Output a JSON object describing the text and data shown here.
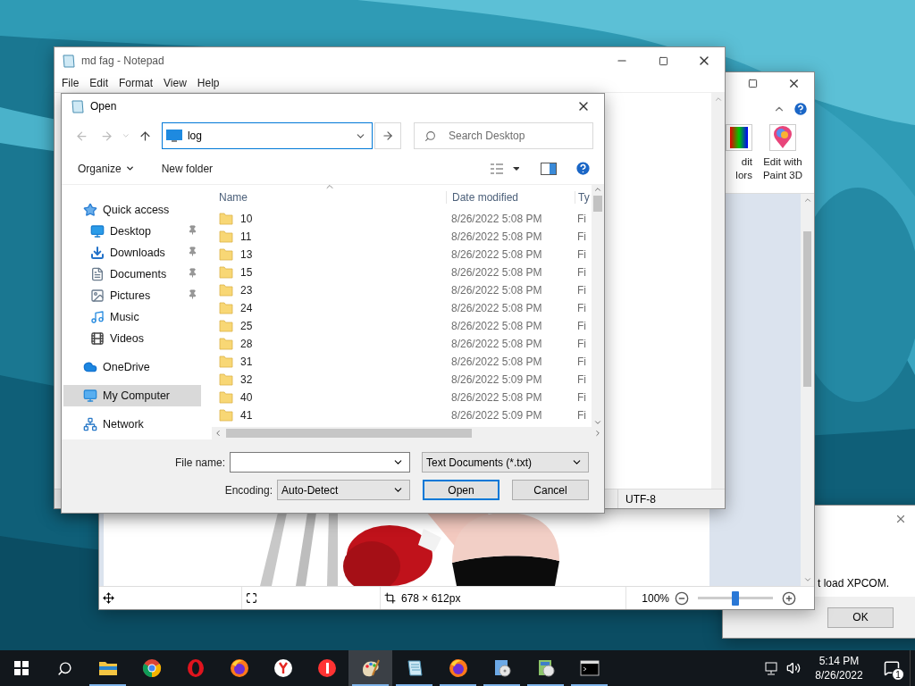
{
  "paint_window": {
    "ribbon_buttons": [
      {
        "kind": "colors",
        "lines": [
          "dit",
          "lors"
        ]
      },
      {
        "kind": "paint3d",
        "lines": [
          "Edit with",
          "Paint 3D"
        ]
      }
    ],
    "zoom_slider": {
      "level": 0.5
    },
    "status_bar": {
      "image_size": "678 × 612px",
      "zoom": "100%"
    }
  },
  "notepad": {
    "title": "md fag - Notepad",
    "menu": [
      "File",
      "Edit",
      "Format",
      "View",
      "Help"
    ],
    "status_bar": {
      "encoding": "UTF-8"
    }
  },
  "open_dialog": {
    "title": "Open",
    "address": "log",
    "search": {
      "placeholder": "Search Desktop"
    },
    "toolbar": {
      "organize": "Organize",
      "new_folder": "New folder"
    },
    "nav_items": [
      {
        "label": "Quick access",
        "kind": "quick",
        "selected": false,
        "children": [
          {
            "label": "Desktop",
            "kind": "desktop",
            "pinned": true,
            "selected": false
          },
          {
            "label": "Downloads",
            "kind": "downloads",
            "pinned": true,
            "selected": false
          },
          {
            "label": "Documents",
            "kind": "documents",
            "pinned": true,
            "selected": false
          },
          {
            "label": "Pictures",
            "kind": "pictures",
            "pinned": true,
            "selected": false
          },
          {
            "label": "Music",
            "kind": "music",
            "pinned": false,
            "selected": false
          },
          {
            "label": "Videos",
            "kind": "videos",
            "pinned": false,
            "selected": false
          }
        ]
      },
      {
        "label": "OneDrive",
        "kind": "onedrive",
        "selected": false
      },
      {
        "label": "My Computer",
        "kind": "computer",
        "selected": true
      },
      {
        "label": "Network",
        "kind": "network",
        "selected": false
      }
    ],
    "columns": [
      "Name",
      "Date modified",
      "Ty"
    ],
    "rows": [
      {
        "name": "10",
        "date": "8/26/2022 5:08 PM",
        "type": "Fi"
      },
      {
        "name": "11",
        "date": "8/26/2022 5:08 PM",
        "type": "Fi"
      },
      {
        "name": "13",
        "date": "8/26/2022 5:08 PM",
        "type": "Fi"
      },
      {
        "name": "15",
        "date": "8/26/2022 5:08 PM",
        "type": "Fi"
      },
      {
        "name": "23",
        "date": "8/26/2022 5:08 PM",
        "type": "Fi"
      },
      {
        "name": "24",
        "date": "8/26/2022 5:08 PM",
        "type": "Fi"
      },
      {
        "name": "25",
        "date": "8/26/2022 5:08 PM",
        "type": "Fi"
      },
      {
        "name": "28",
        "date": "8/26/2022 5:08 PM",
        "type": "Fi"
      },
      {
        "name": "31",
        "date": "8/26/2022 5:08 PM",
        "type": "Fi"
      },
      {
        "name": "32",
        "date": "8/26/2022 5:09 PM",
        "type": "Fi"
      },
      {
        "name": "40",
        "date": "8/26/2022 5:08 PM",
        "type": "Fi"
      },
      {
        "name": "41",
        "date": "8/26/2022 5:09 PM",
        "type": "Fi"
      }
    ],
    "file_name": {
      "label": "File name:"
    },
    "file_type": "Text Documents (*.txt)",
    "encoding": {
      "label": "Encoding:",
      "value": "Auto-Detect"
    },
    "buttons": [
      "Open",
      "Cancel"
    ]
  },
  "error_dialog": {
    "message": "t load XPCOM.",
    "button": "OK"
  },
  "taskbar": {
    "apps": [
      {
        "kind": "explorer",
        "running": true,
        "selected": false
      },
      {
        "kind": "chrome",
        "running": false,
        "selected": false
      },
      {
        "kind": "opera",
        "running": false,
        "selected": false
      },
      {
        "kind": "firefox",
        "running": false,
        "selected": false
      },
      {
        "kind": "ybrowser",
        "running": false,
        "selected": false
      },
      {
        "kind": "yandex",
        "running": false,
        "selected": false
      },
      {
        "kind": "paint",
        "running": true,
        "selected": true
      },
      {
        "kind": "notepad",
        "running": true,
        "selected": false
      },
      {
        "kind": "firefox",
        "running": true,
        "selected": false
      },
      {
        "kind": "installer",
        "running": true,
        "selected": false
      },
      {
        "kind": "setup",
        "running": true,
        "selected": false
      },
      {
        "kind": "console",
        "running": true,
        "selected": false
      }
    ],
    "clock": {
      "time": "5:14 PM",
      "date": "8/26/2022"
    },
    "notifications": "1"
  }
}
